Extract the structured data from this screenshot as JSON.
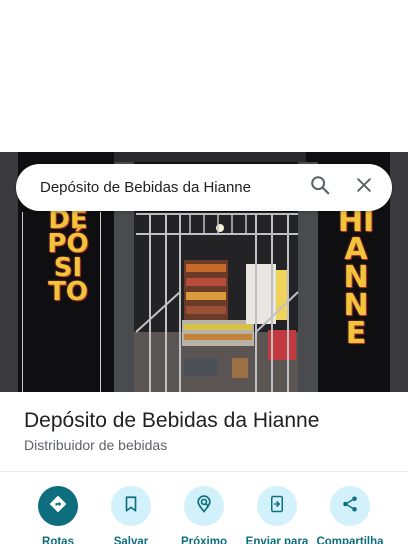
{
  "search": {
    "query": "Depósito de Bebidas da Hianne",
    "search_icon": "search-icon",
    "close_icon": "close-icon"
  },
  "photo": {
    "sign_left": "DEPÓSITO",
    "sign_right": "HIANNE"
  },
  "place": {
    "title": "Depósito de Bebidas da Hianne",
    "category": "Distribuidor de bebidas"
  },
  "actions": [
    {
      "label": "Rotas",
      "icon": "directions-icon"
    },
    {
      "label": "Salvar",
      "icon": "bookmark-icon"
    },
    {
      "label": "Próximo",
      "icon": "nearby-icon"
    },
    {
      "label": "Enviar para",
      "icon": "send-to-phone-icon"
    },
    {
      "label": "Compartilha",
      "icon": "share-icon"
    }
  ],
  "colors": {
    "accent": "#0f6e7e",
    "action_circle": "#d2f1fa",
    "title": "#202124",
    "subtitle": "#5f6368"
  }
}
